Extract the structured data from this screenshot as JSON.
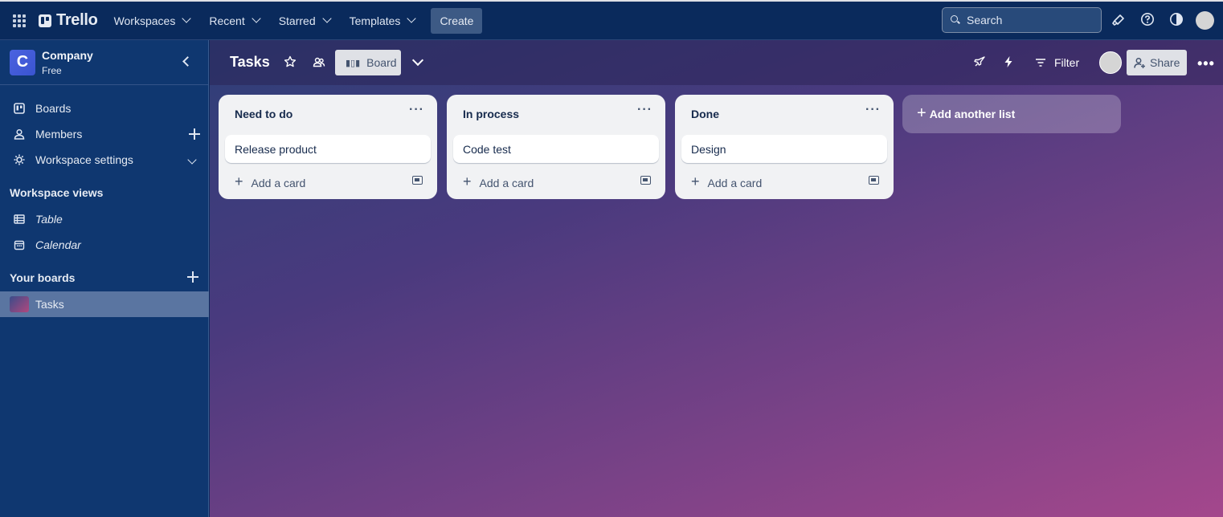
{
  "topbar": {
    "brand": "Trello",
    "menus": [
      "Workspaces",
      "Recent",
      "Starred",
      "Templates"
    ],
    "create_label": "Create",
    "search_placeholder": "Search"
  },
  "sidebar": {
    "workspace_initial": "C",
    "workspace_name": "Company",
    "workspace_plan": "Free",
    "items": [
      {
        "label": "Boards",
        "icon": "board-icon"
      },
      {
        "label": "Members",
        "icon": "member-icon"
      },
      {
        "label": "Workspace settings",
        "icon": "gear-icon"
      }
    ],
    "views_heading": "Workspace views",
    "views": [
      {
        "label": "Table",
        "icon": "table-icon"
      },
      {
        "label": "Calendar",
        "icon": "calendar-icon"
      }
    ],
    "boards_heading": "Your boards",
    "boards": [
      {
        "label": "Tasks"
      }
    ]
  },
  "board": {
    "title": "Tasks",
    "view_label": "Board",
    "filter_label": "Filter",
    "share_label": "Share",
    "lists": [
      {
        "title": "Need to do",
        "cards": [
          "Release product"
        ],
        "add_card": "Add a card"
      },
      {
        "title": "In process",
        "cards": [
          "Code test"
        ],
        "add_card": "Add a card"
      },
      {
        "title": "Done",
        "cards": [
          "Design"
        ],
        "add_card": "Add a card"
      }
    ],
    "add_list_label": "Add another list"
  },
  "colors": {
    "topbar": "#0a2a5c",
    "sidebar": "#0f3770",
    "board_gradient_start": "#2e3f78",
    "board_gradient_end": "#a4478c",
    "list_bg": "#f1f2f4"
  }
}
